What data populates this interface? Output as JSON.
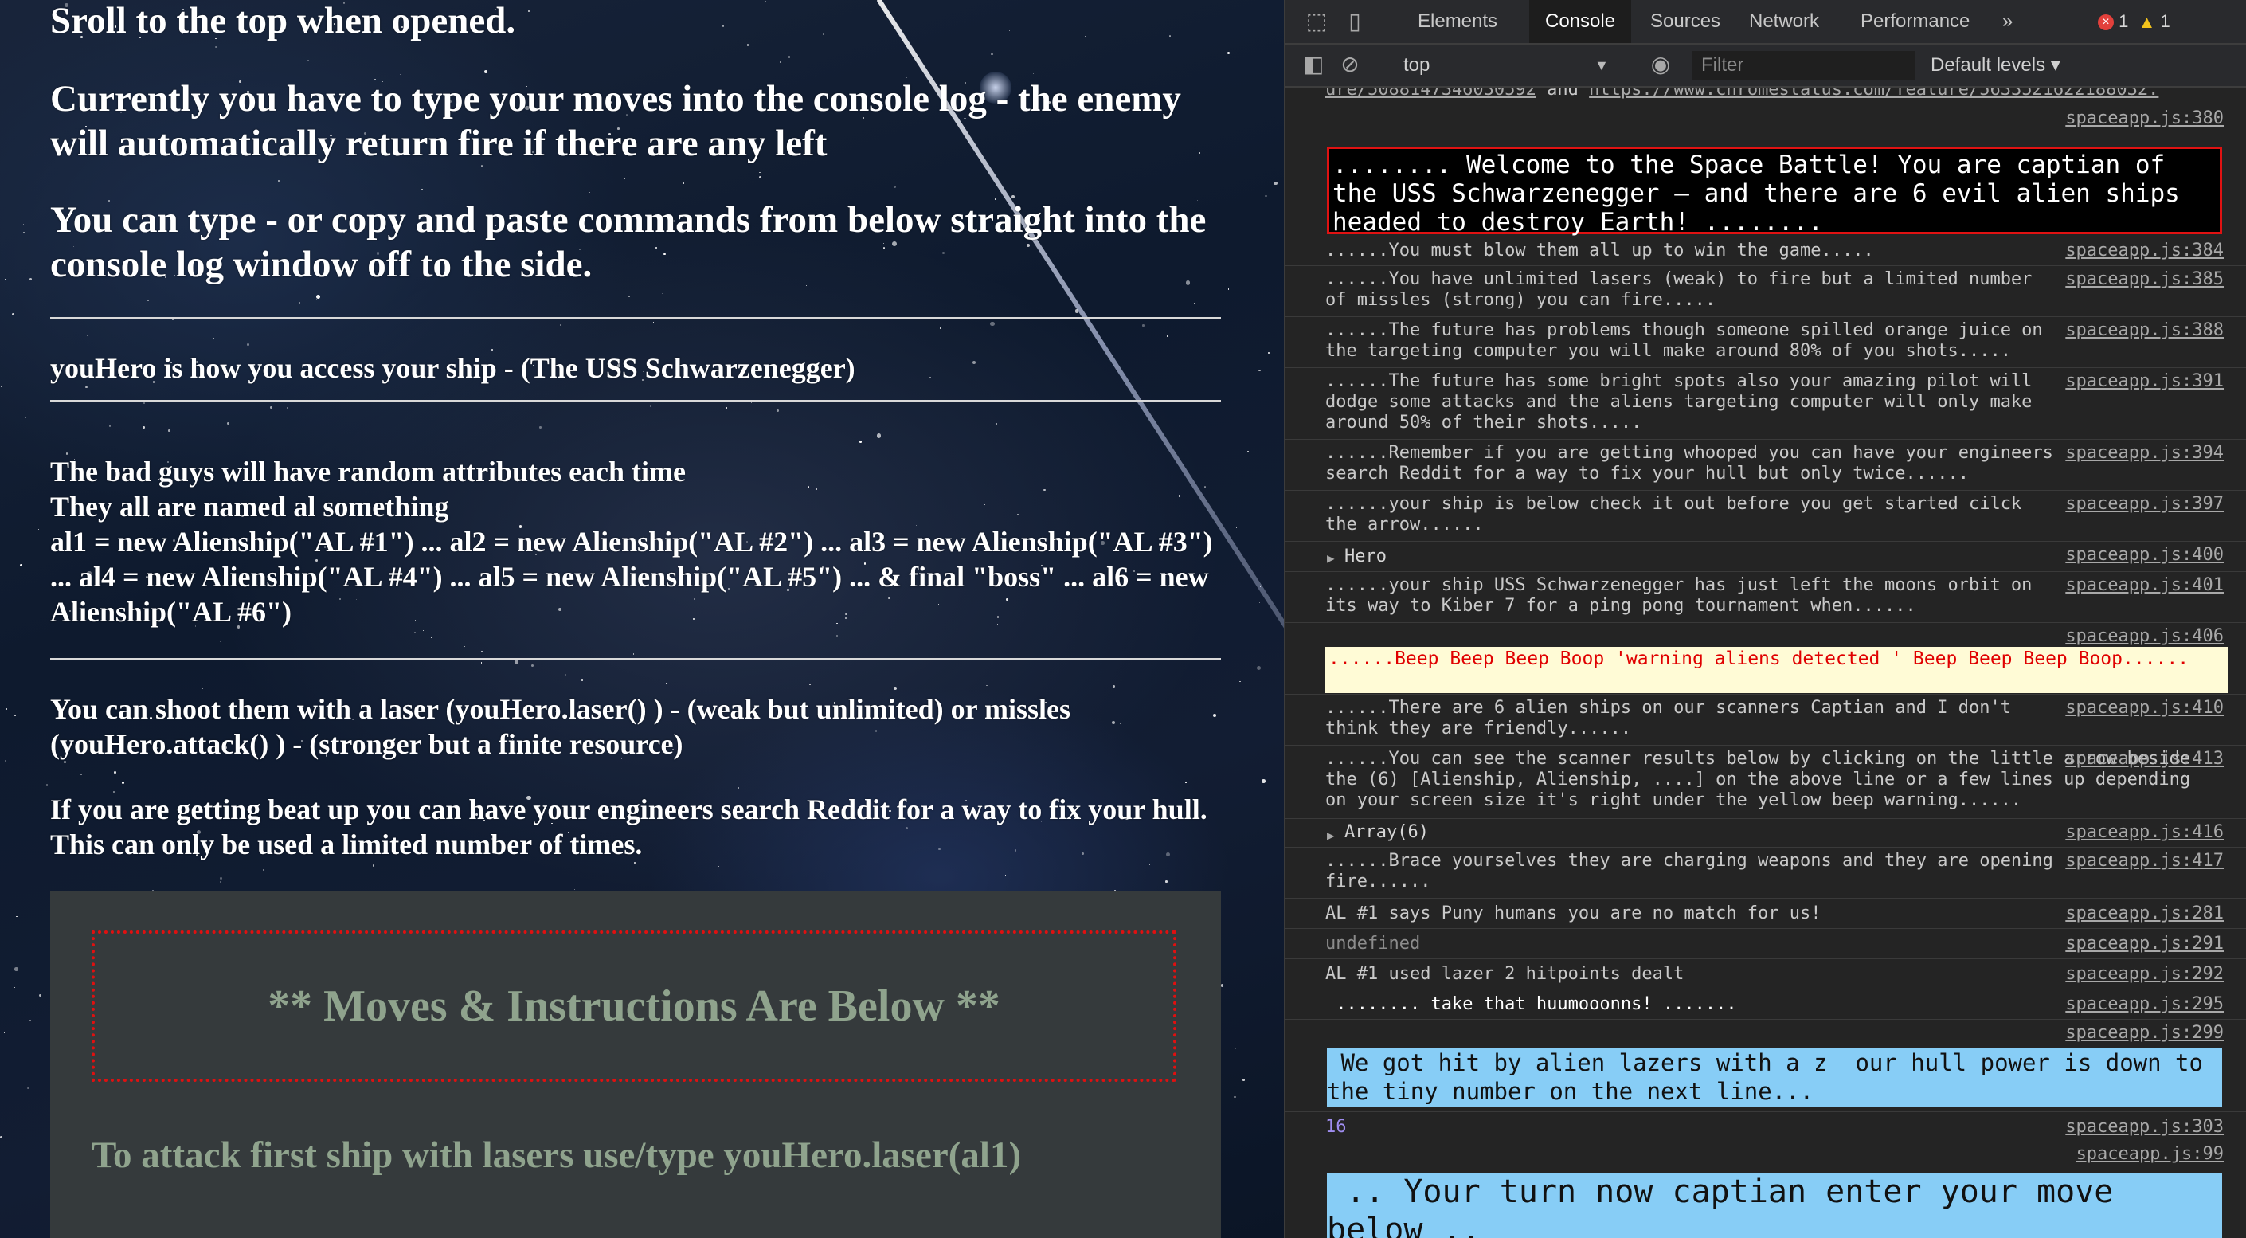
{
  "game": {
    "line1": "Sroll to the top when opened.",
    "line2": "Currently you have to type your moves into the console log - the enemy will automatically return fire if there are any left",
    "line3": "You can type - or copy and paste commands from below straight into the console log window off to the side.",
    "hero_access": "youHero is how you access your ship - (The USS Schwarzenegger)",
    "bad_guys_1": "The bad guys will have random attributes each time",
    "bad_guys_2": "They all are named al something",
    "bad_guys_3": "al1 = new Alienship(\"AL #1\") ... al2 = new Alienship(\"AL #2\") ... al3 = new Alienship(\"AL #3\") ... al4 = new Alienship(\"AL #4\") ... al5 = new Alienship(\"AL #5\") ... & final \"boss\" ... al6 = new Alienship(\"AL #6\")",
    "shoot": "You can shoot them with a laser (youHero.laser() ) - (weak but unlimited) or missles (youHero.attack() ) - (stronger but a finite resource)",
    "repair": "If you are getting beat up you can have your engineers search Reddit for a way to fix your hull. This can only be used a limited number of times.",
    "moves_title": "** Moves & Instructions Are Below **",
    "first_move": "To attack first ship with lasers use/type youHero.laser(al1)"
  },
  "devtools": {
    "tabs": [
      "Elements",
      "Console",
      "Sources",
      "Network",
      "Performance"
    ],
    "more_tabs": "»",
    "error_count": "1",
    "warning_count": "1",
    "context": "top",
    "filter_placeholder": "Filter",
    "levels": "Default levels ▾",
    "truncated_link_1": "ure/5088147346030592",
    "truncated_and": " and ",
    "truncated_link_2": "https://www.chromestatus.com/feature/5633521622188032.",
    "messages": [
      {
        "text": "........ Welcome to the Space Battle! You are captian of the USS Schwarzenegger – and there are 6 evil alien ships headed to destroy Earth! ........",
        "source": "spaceapp.js:380"
      },
      {
        "text": "......You must blow them all up to win the game.....",
        "source": "spaceapp.js:384"
      },
      {
        "text": "......You have unlimited lasers (weak) to fire but a limited number of missles (strong) you can fire.....",
        "source": "spaceapp.js:385"
      },
      {
        "text": "......The future has problems though someone spilled orange juice on the targeting computer you will make around 80% of you shots.....",
        "source": "spaceapp.js:388"
      },
      {
        "text": "......The future has some bright spots also your amazing pilot will dodge some attacks and the aliens targeting computer will only make around 50% of their shots.....",
        "source": "spaceapp.js:391"
      },
      {
        "text": "......Remember if you are getting whooped you can have your engineers search Reddit for a way to fix your hull but only twice......",
        "source": "spaceapp.js:394"
      },
      {
        "text": "......your ship is below check it out before you get started cilck the arrow......",
        "source": "spaceapp.js:397"
      },
      {
        "text": "Hero",
        "source": "spaceapp.js:400"
      },
      {
        "text": "......your ship USS Schwarzenegger has just left the moons orbit on its way to Kiber 7 for a ping pong tournament when......",
        "source": "spaceapp.js:401"
      },
      {
        "text": "......Beep Beep Beep Boop 'warning aliens detected ' Beep Beep Beep Boop......",
        "source": "spaceapp.js:406"
      },
      {
        "text": "......There are 6 alien ships on our scanners Captian and I don't think they are friendly......",
        "source": "spaceapp.js:410"
      },
      {
        "text": "......You can see the scanner results below by clicking on the little arrow beside the (6) [Alienship, Alienship, ....] on the above line or a few lines up depending on your screen size it's right under the yellow beep warning......",
        "source": "spaceapp.js:413"
      },
      {
        "text": "Array(6)",
        "source": "spaceapp.js:416"
      },
      {
        "text": "......Brace yourselves they are charging weapons and they are opening fire......",
        "source": "spaceapp.js:417"
      },
      {
        "text": "AL #1 says Puny humans you are no match for us!",
        "source": "spaceapp.js:281"
      },
      {
        "text": "undefined",
        "source": "spaceapp.js:291"
      },
      {
        "text": "AL #1 used lazer 2 hitpoints dealt",
        "source": "spaceapp.js:292"
      },
      {
        "text": " ........ take that huumooonns! .......",
        "source": "spaceapp.js:295"
      },
      {
        "text": " We got hit by alien lazers with a z  our hull power is down to the tiny number on the next line...",
        "source": "spaceapp.js:299"
      },
      {
        "text": "16",
        "source": "spaceapp.js:303"
      },
      {
        "text": " .. Your turn now captian enter your move below ..",
        "source": "spaceapp.js:99"
      }
    ]
  },
  "colors": {
    "error_red": "#e01010",
    "moves_text": "#8fa38d",
    "warning_bg": "#fffbd6",
    "highlight_blue": "#87cdf6"
  }
}
